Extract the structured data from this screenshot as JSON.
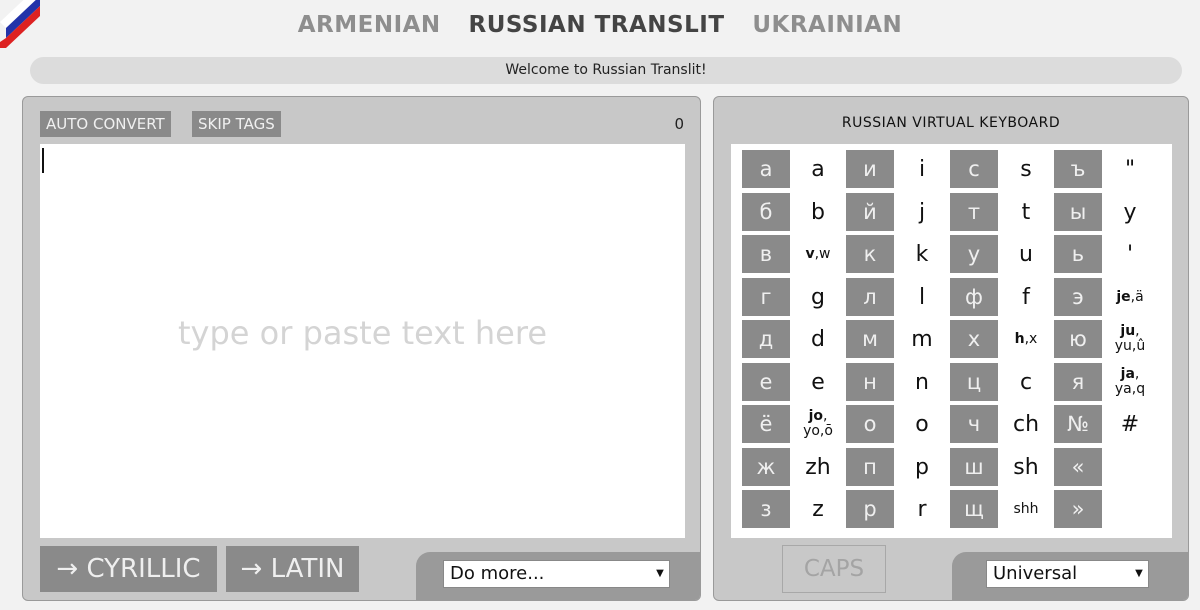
{
  "nav": {
    "items": [
      {
        "label": "ARMENIAN",
        "state": "muted"
      },
      {
        "label": "RUSSIAN TRANSLIT",
        "state": "active"
      },
      {
        "label": "UKRAINIAN",
        "state": "muted"
      }
    ]
  },
  "welcome": "Welcome to Russian Translit!",
  "editor": {
    "auto_convert_label": "AUTO CONVERT",
    "skip_tags_label": "SKIP TAGS",
    "counter": "0",
    "placeholder": "type or paste text here",
    "to_cyrillic_label": "→ CYRILLIC",
    "to_latin_label": "→ LATIN",
    "more_select": "Do more..."
  },
  "keyboard": {
    "title": "RUSSIAN VIRTUAL KEYBOARD",
    "columns": [
      [
        {
          "cyr": "а",
          "lat": "a"
        },
        {
          "cyr": "б",
          "lat": "b"
        },
        {
          "cyr": "в",
          "lat": "v,w"
        },
        {
          "cyr": "г",
          "lat": "g"
        },
        {
          "cyr": "д",
          "lat": "d"
        },
        {
          "cyr": "е",
          "lat": "e"
        },
        {
          "cyr": "ё",
          "lat": "jo,|yo,ō"
        },
        {
          "cyr": "ж",
          "lat": "zh"
        },
        {
          "cyr": "з",
          "lat": "z"
        }
      ],
      [
        {
          "cyr": "и",
          "lat": "i"
        },
        {
          "cyr": "й",
          "lat": "j"
        },
        {
          "cyr": "к",
          "lat": "k"
        },
        {
          "cyr": "л",
          "lat": "l"
        },
        {
          "cyr": "м",
          "lat": "m"
        },
        {
          "cyr": "н",
          "lat": "n"
        },
        {
          "cyr": "о",
          "lat": "o"
        },
        {
          "cyr": "п",
          "lat": "p"
        },
        {
          "cyr": "р",
          "lat": "r"
        }
      ],
      [
        {
          "cyr": "с",
          "lat": "s"
        },
        {
          "cyr": "т",
          "lat": "t"
        },
        {
          "cyr": "у",
          "lat": "u"
        },
        {
          "cyr": "ф",
          "lat": "f"
        },
        {
          "cyr": "х",
          "lat": "h,x"
        },
        {
          "cyr": "ц",
          "lat": "c"
        },
        {
          "cyr": "ч",
          "lat": "ch"
        },
        {
          "cyr": "ш",
          "lat": "sh"
        },
        {
          "cyr": "щ",
          "lat": "shh"
        }
      ],
      [
        {
          "cyr": "ъ",
          "lat": "\""
        },
        {
          "cyr": "ы",
          "lat": "y"
        },
        {
          "cyr": "ь",
          "lat": "'"
        },
        {
          "cyr": "э",
          "lat": "je,ä"
        },
        {
          "cyr": "ю",
          "lat": "ju,|yu,û"
        },
        {
          "cyr": "я",
          "lat": "ja,|ya,q"
        },
        {
          "cyr": "№",
          "lat": "#"
        },
        {
          "cyr": "«",
          "lat": ""
        },
        {
          "cyr": "»",
          "lat": ""
        }
      ]
    ],
    "caps_label": "CAPS",
    "mode_select": "Universal"
  },
  "colors": {
    "key_bg": "#8a8a8a",
    "panel_bg": "#c8c8c8",
    "nav_active": "#444444",
    "nav_muted": "#8e8e8e"
  }
}
